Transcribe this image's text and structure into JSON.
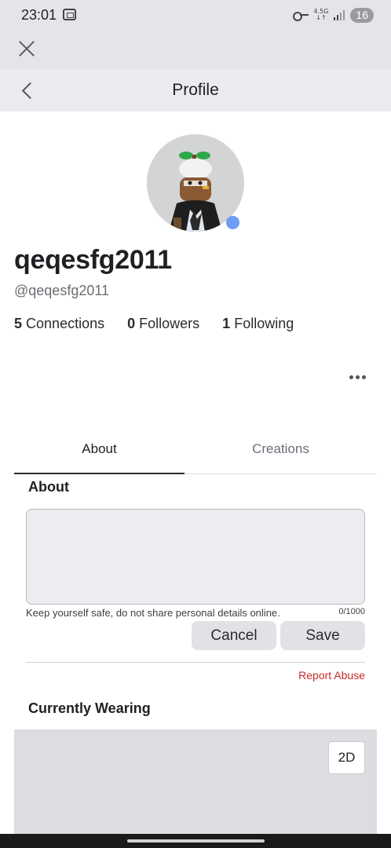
{
  "status_bar": {
    "time": "23:01",
    "network_label_top": "4.5G",
    "network_label_bottom": "↓↑",
    "battery": "16",
    "icons": [
      "screenshot-icon",
      "vpn-key-icon",
      "signal-icon"
    ]
  },
  "header": {
    "title": "Profile"
  },
  "profile": {
    "display_name": "qeqesfg2011",
    "username": "@qeqesfg2011",
    "presence_color": "#6f9cf5",
    "stats": [
      {
        "count": "5",
        "label": "Connections"
      },
      {
        "count": "0",
        "label": "Followers"
      },
      {
        "count": "1",
        "label": "Following"
      }
    ]
  },
  "tabs": [
    {
      "label": "About",
      "active": true
    },
    {
      "label": "Creations",
      "active": false
    }
  ],
  "about": {
    "heading": "About",
    "textarea_value": "",
    "safety_note": "Keep yourself safe, do not share personal details online.",
    "char_count": "0/1000",
    "cancel_label": "Cancel",
    "save_label": "Save",
    "report_label": "Report Abuse"
  },
  "wearing": {
    "heading": "Currently Wearing",
    "view_toggle_label": "2D"
  },
  "colors": {
    "accent_report": "#c42b2b",
    "presence": "#6f9cf5",
    "header_bg": "#eaebee"
  }
}
